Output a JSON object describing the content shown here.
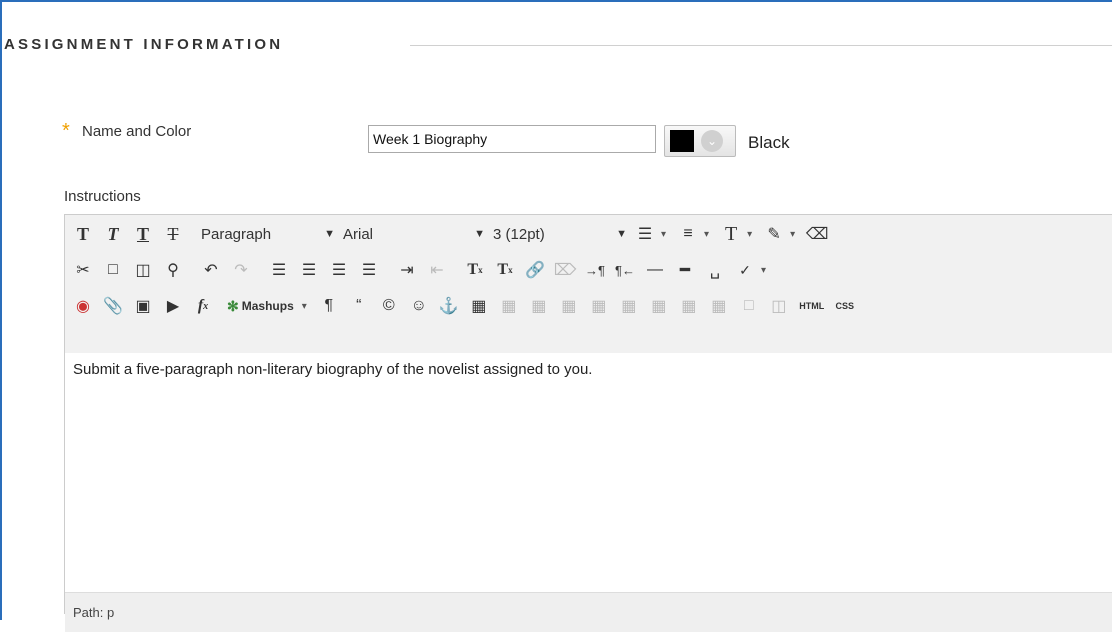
{
  "section": {
    "title": "ASSIGNMENT INFORMATION"
  },
  "name_field": {
    "required_mark": "*",
    "label": "Name and Color",
    "value": "Week 1 Biography"
  },
  "color": {
    "swatch_hex": "#000000",
    "name": "Black"
  },
  "instructions": {
    "label": "Instructions",
    "toolbar": {
      "format_select": "Paragraph",
      "font_select": "Arial",
      "size_select": "3 (12pt)",
      "mashups_label": "Mashups",
      "html_label": "HTML",
      "css_label": "CSS"
    },
    "content": "Submit a five-paragraph non-literary biography of the novelist assigned to you.",
    "path_label": "Path:",
    "path_value": "p"
  }
}
